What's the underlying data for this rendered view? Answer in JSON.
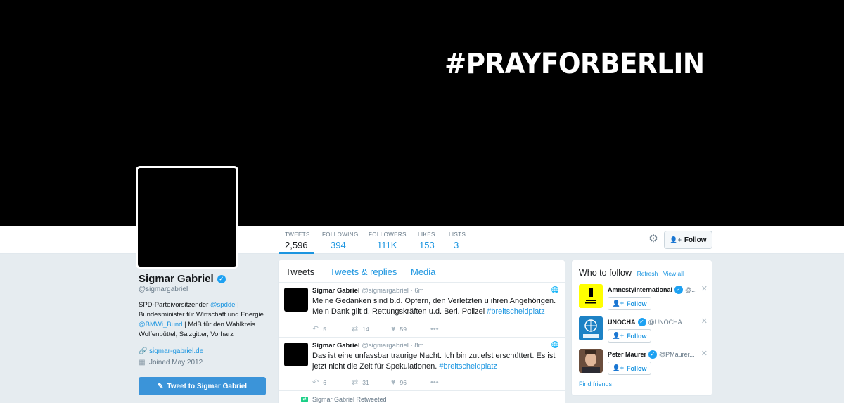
{
  "banner": {
    "hashtag": "#PRAYFORBERLIN"
  },
  "stats": [
    {
      "label": "Tweets",
      "value": "2,596"
    },
    {
      "label": "Following",
      "value": "394"
    },
    {
      "label": "Followers",
      "value": "111K"
    },
    {
      "label": "Likes",
      "value": "153"
    },
    {
      "label": "Lists",
      "value": "3"
    }
  ],
  "header": {
    "follow_label": "Follow",
    "settings_icon": "gear-icon"
  },
  "profile": {
    "name": "Sigmar Gabriel",
    "handle": "@sigmargabriel",
    "bio": {
      "p1": "SPD-Parteivorsitzender ",
      "link1": "@spdde",
      "p2": " | Bundesminister für Wirtschaft und Energie ",
      "link2": "@BMWi_Bund",
      "p3": " | MdB für den Wahlkreis Wolfenbüttel, Salzgitter, Vorharz"
    },
    "website": "sigmar-gabriel.de",
    "joined": "Joined May 2012",
    "tweet_to_label": "Tweet to Sigmar Gabriel"
  },
  "timeline": {
    "tabs": [
      "Tweets",
      "Tweets & replies",
      "Media"
    ],
    "tweets": [
      {
        "name": "Sigmar Gabriel",
        "handle": "@sigmargabriel",
        "dot": "·",
        "time": "6m",
        "text": "Meine Gedanken sind b.d. Opfern, den Verletzten u ihren Angehörigen. Mein Dank gilt d. Rettungskräften u.d. Berl. Polizei ",
        "hashtag": "#breitscheidplatz",
        "replies": "5",
        "retweets": "14",
        "likes": "59"
      },
      {
        "name": "Sigmar Gabriel",
        "handle": "@sigmargabriel",
        "dot": "·",
        "time": "8m",
        "text": "Das ist eine unfassbar traurige Nacht. Ich bin zutiefst erschüttert. Es ist jetzt nicht die Zeit für Spekulationen. ",
        "hashtag": "#breitscheidplatz",
        "replies": "6",
        "retweets": "31",
        "likes": "96"
      }
    ],
    "retweeted_label": "Sigmar Gabriel Retweeted"
  },
  "who_to_follow": {
    "title": "Who to follow",
    "sep": " · ",
    "refresh": "Refresh",
    "view_all": "View all",
    "suggestions": [
      {
        "name": "AmnestyInternational",
        "handle": "@...",
        "follow": "Follow",
        "avatar_color": "#ffff00",
        "avatar_text": "AMNESTY INTERNATIONAL"
      },
      {
        "name": "UNOCHA",
        "handle": "@UNOCHA",
        "follow": "Follow",
        "avatar_color": "#1d82c5",
        "avatar_text": "OCHA"
      },
      {
        "name": "Peter Maurer",
        "handle": "@PMaurer...",
        "follow": "Follow",
        "avatar_color": "#8a6a55",
        "avatar_text": ""
      }
    ],
    "find_friends": "Find friends"
  }
}
